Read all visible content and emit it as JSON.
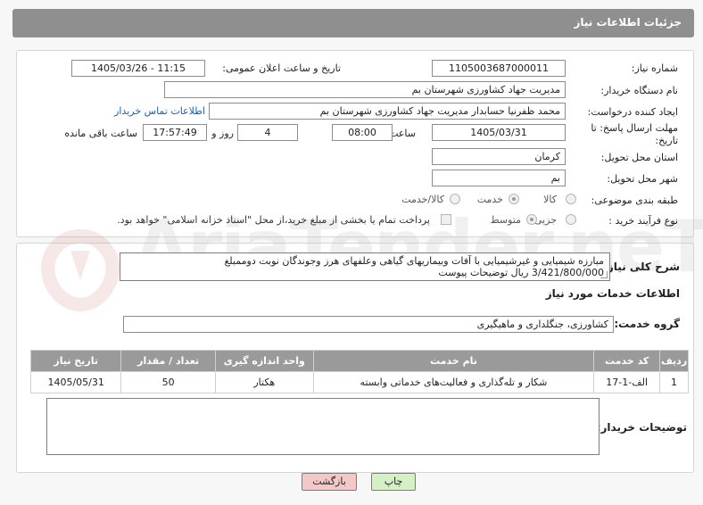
{
  "header": {
    "title": "جزئیات اطلاعات نیاز"
  },
  "form": {
    "need_number_label": "شماره نیاز:",
    "need_number": "1105003687000011",
    "announce_label": "تاریخ و ساعت اعلان عمومی:",
    "announce_value": "1405/03/26 - 11:15",
    "buyer_org_label": "نام دستگاه خریدار:",
    "buyer_org": "مدیریت جهاد کشاورزی شهرستان بم",
    "creator_label": "ایجاد کننده درخواست:",
    "creator": "محمد ظفرنیا حسابدار مدیریت جهاد کشاورزی شهرستان بم",
    "contact_link": "اطلاعات تماس خریدار",
    "deadline_label": "مهلت ارسال پاسخ: تا تاریخ:",
    "deadline_date": "1405/03/31",
    "time_label": "ساعت",
    "deadline_time": "08:00",
    "days_count": "4",
    "days_label": "روز و",
    "remaining_time": "17:57:49",
    "remaining_label": "ساعت باقی مانده",
    "province_label": "استان محل تحویل:",
    "province": "کرمان",
    "city_label": "شهر محل تحویل:",
    "city": "بم",
    "category_label": "طبقه بندی موضوعی:",
    "category_options": [
      "کالا",
      "خدمت",
      "کالا/خدمت"
    ],
    "category_selected": "خدمت",
    "process_label": "نوع فرآیند خرید :",
    "process_options": [
      "جزیی",
      "متوسط"
    ],
    "process_selected": "متوسط",
    "payment_note": "پرداخت تمام یا بخشی از مبلغ خرید،از محل \"اسناد خزانه اسلامی\" خواهد بود."
  },
  "description": {
    "label": "شرح کلی نیاز:",
    "line1": "مبارزه شیمیایی و غیرشیمیایی با آفات وبیماریهای گیاهی وعلفهای هرز وجوندگان نوبت دوممبلغ",
    "line2": "3/421/800/000 ریال توضیحات پیوست"
  },
  "services": {
    "section_title": "اطلاعات خدمات مورد نیاز",
    "group_label": "گروه خدمت:",
    "group_value": "کشاورزی، جنگلداری و ماهیگیری",
    "columns": [
      "ردیف",
      "کد خدمت",
      "نام خدمت",
      "واحد اندازه گیری",
      "تعداد / مقدار",
      "تاریخ نیاز"
    ],
    "rows": [
      [
        "1",
        "الف-1-17",
        "شکار و تله‌گذاری و فعالیت‌های خدماتی وابسته",
        "هکتار",
        "50",
        "1405/05/31"
      ]
    ]
  },
  "buyer_notes": {
    "label": "توضیحات خریدار:",
    "value": ""
  },
  "buttons": {
    "print": "چاپ",
    "back": "بازگشت"
  },
  "watermark": {
    "text": "AriaTender.neT"
  }
}
